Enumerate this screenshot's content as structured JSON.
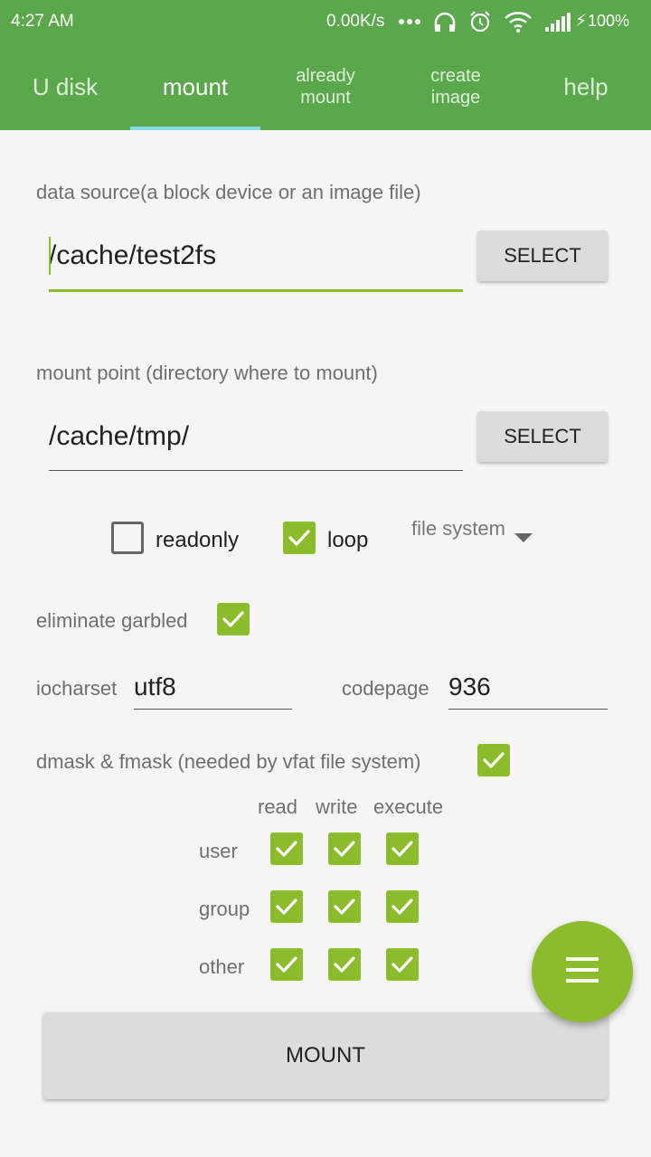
{
  "status_bar": {
    "time": "4:27 AM",
    "net_speed": "0.00K/s",
    "battery": "100%"
  },
  "tabs": [
    {
      "label": "U disk"
    },
    {
      "label": "mount"
    },
    {
      "label_line1": "already",
      "label_line2": "mount"
    },
    {
      "label_line1": "create",
      "label_line2": "image"
    },
    {
      "label": "help"
    }
  ],
  "source": {
    "label": "data source(a block device or an image file)",
    "value": "/cache/test2fs",
    "button": "SELECT"
  },
  "mount_point": {
    "label": "mount point (directory where to mount)",
    "value": "/cache/tmp/",
    "button": "SELECT"
  },
  "options": {
    "readonly": {
      "label": "readonly",
      "checked": false
    },
    "loop": {
      "label": "loop",
      "checked": true
    },
    "file_system": {
      "label": "file system"
    }
  },
  "eliminate_garbled": {
    "label": "eliminate garbled",
    "checked": true
  },
  "iocharset": {
    "label": "iocharset",
    "value": "utf8"
  },
  "codepage": {
    "label": "codepage",
    "value": "936"
  },
  "mask": {
    "label": "dmask & fmask (needed by vfat file system)",
    "checked": true,
    "columns": [
      "read",
      "write",
      "execute"
    ],
    "rows": [
      "user",
      "group",
      "other"
    ]
  },
  "mount_button": "MOUNT",
  "colors": {
    "app_bar": "#5aa84b",
    "accent": "#8bbc2c",
    "tab_indicator": "#80deea"
  }
}
